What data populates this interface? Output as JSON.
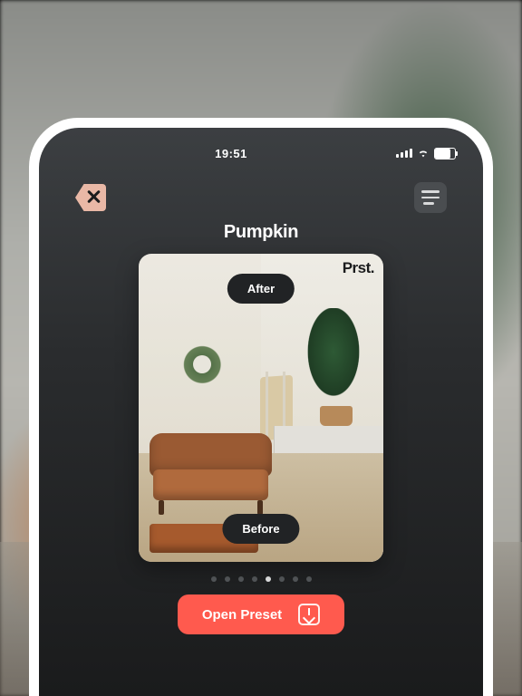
{
  "status": {
    "time": "19:51"
  },
  "header": {
    "title": "Pumpkin"
  },
  "brand": "Prst.",
  "pills": {
    "after": "After",
    "before": "Before"
  },
  "pager": {
    "count": 8,
    "active_index": 4
  },
  "cta": {
    "label": "Open Preset"
  },
  "colors": {
    "accent": "#ff5a4e",
    "back_btn": "#e9b8a6"
  }
}
